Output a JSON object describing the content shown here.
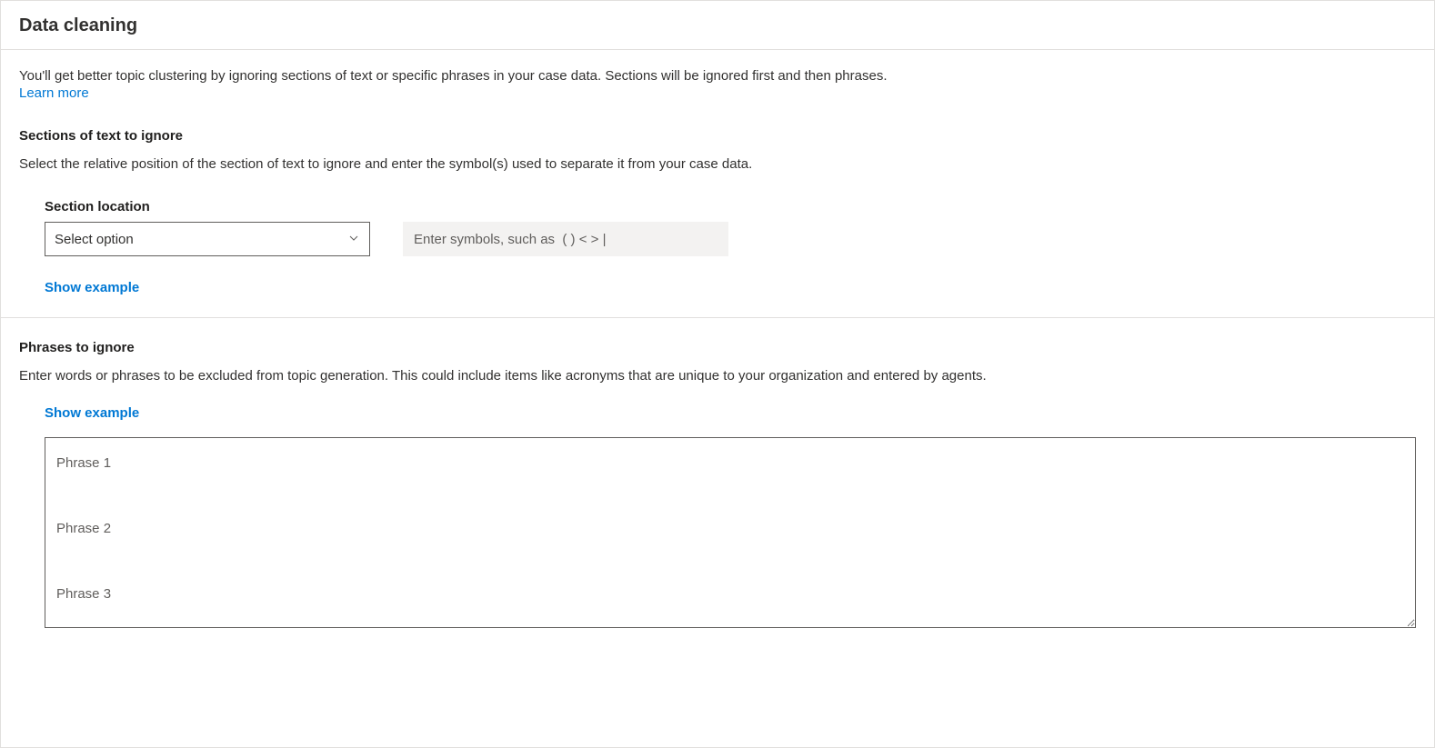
{
  "header": {
    "title": "Data cleaning"
  },
  "intro": {
    "text": "You'll get better topic clustering by ignoring sections of text or specific phrases in your case data. Sections will be ignored first and then phrases.",
    "learn_more": "Learn more"
  },
  "sections": {
    "heading": "Sections of text to ignore",
    "description": "Select the relative position of the section of text to ignore and enter the symbol(s) used to separate it from your case data.",
    "location_label": "Section location",
    "select_placeholder": "Select option",
    "symbols_placeholder": "Enter symbols, such as  ( ) < > |",
    "show_example": "Show example"
  },
  "phrases": {
    "heading": "Phrases to ignore",
    "description": "Enter words or phrases to be excluded from topic generation. This could include items like acronyms that are unique to your organization and entered by agents.",
    "show_example": "Show example",
    "textarea_placeholder": "Phrase 1\n\nPhrase 2\n\nPhrase 3"
  }
}
